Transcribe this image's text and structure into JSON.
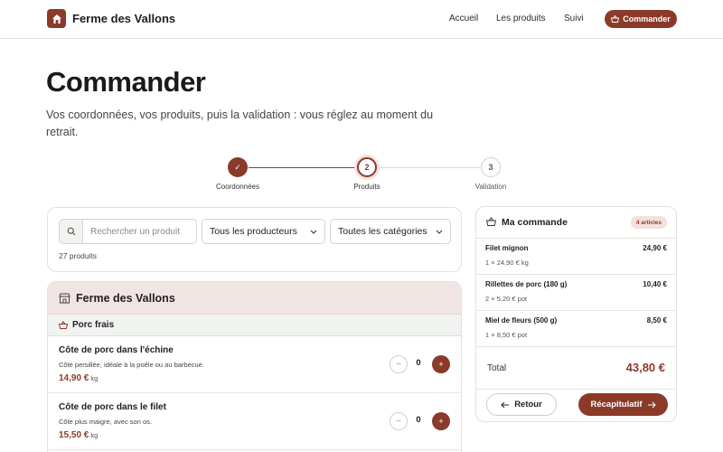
{
  "brand": {
    "name": "Ferme des Vallons",
    "logo_icon": "house-icon",
    "accent": "#8b3a2a"
  },
  "nav": {
    "links": [
      "Accueil",
      "Les produits",
      "Suivi"
    ],
    "cta_label": "Commander",
    "cta_icon": "basket-icon"
  },
  "page": {
    "title": "Commander",
    "subtitle": "Vos coordonnées, vos produits, puis la validation : vous réglez au moment du retrait."
  },
  "stepper": {
    "steps": [
      {
        "number": "✓",
        "label": "Coordonnées",
        "state": "done"
      },
      {
        "number": "2",
        "label": "Produits",
        "state": "current"
      },
      {
        "number": "3",
        "label": "Validation",
        "state": "todo"
      }
    ]
  },
  "filters": {
    "search_placeholder": "Rechercher un produit",
    "search_value": "",
    "producer_select": "Tous les producteurs",
    "category_select": "Toutes les catégories",
    "count_text": "27 produits"
  },
  "producer": {
    "name": "Ferme des Vallons",
    "category": "Porc frais",
    "products": [
      {
        "name": "Côte de porc dans l'échine",
        "desc": "Côte persillée, idéale à la poêle ou au barbecue.",
        "price": "14,90 €",
        "unit": "kg",
        "qty": "0"
      },
      {
        "name": "Côte de porc dans le filet",
        "desc": "Côte plus maigre, avec son os.",
        "price": "15,50 €",
        "unit": "kg",
        "qty": "0"
      }
    ]
  },
  "order": {
    "title": "Ma commande",
    "badge": "4 articles",
    "lines": [
      {
        "name": "Filet mignon",
        "price": "24,90 €",
        "detail": "1 × 24,90 € kg"
      },
      {
        "name": "Rillettes de porc (180 g)",
        "price": "10,40 €",
        "detail": "2 × 5,20 € pot"
      },
      {
        "name": "Miel de fleurs (500 g)",
        "price": "8,50 €",
        "detail": "1 × 8,50 € pot"
      }
    ],
    "total_label": "Total",
    "total_value": "43,80 €",
    "back_label": "Retour",
    "next_label": "Récapitulatif"
  }
}
